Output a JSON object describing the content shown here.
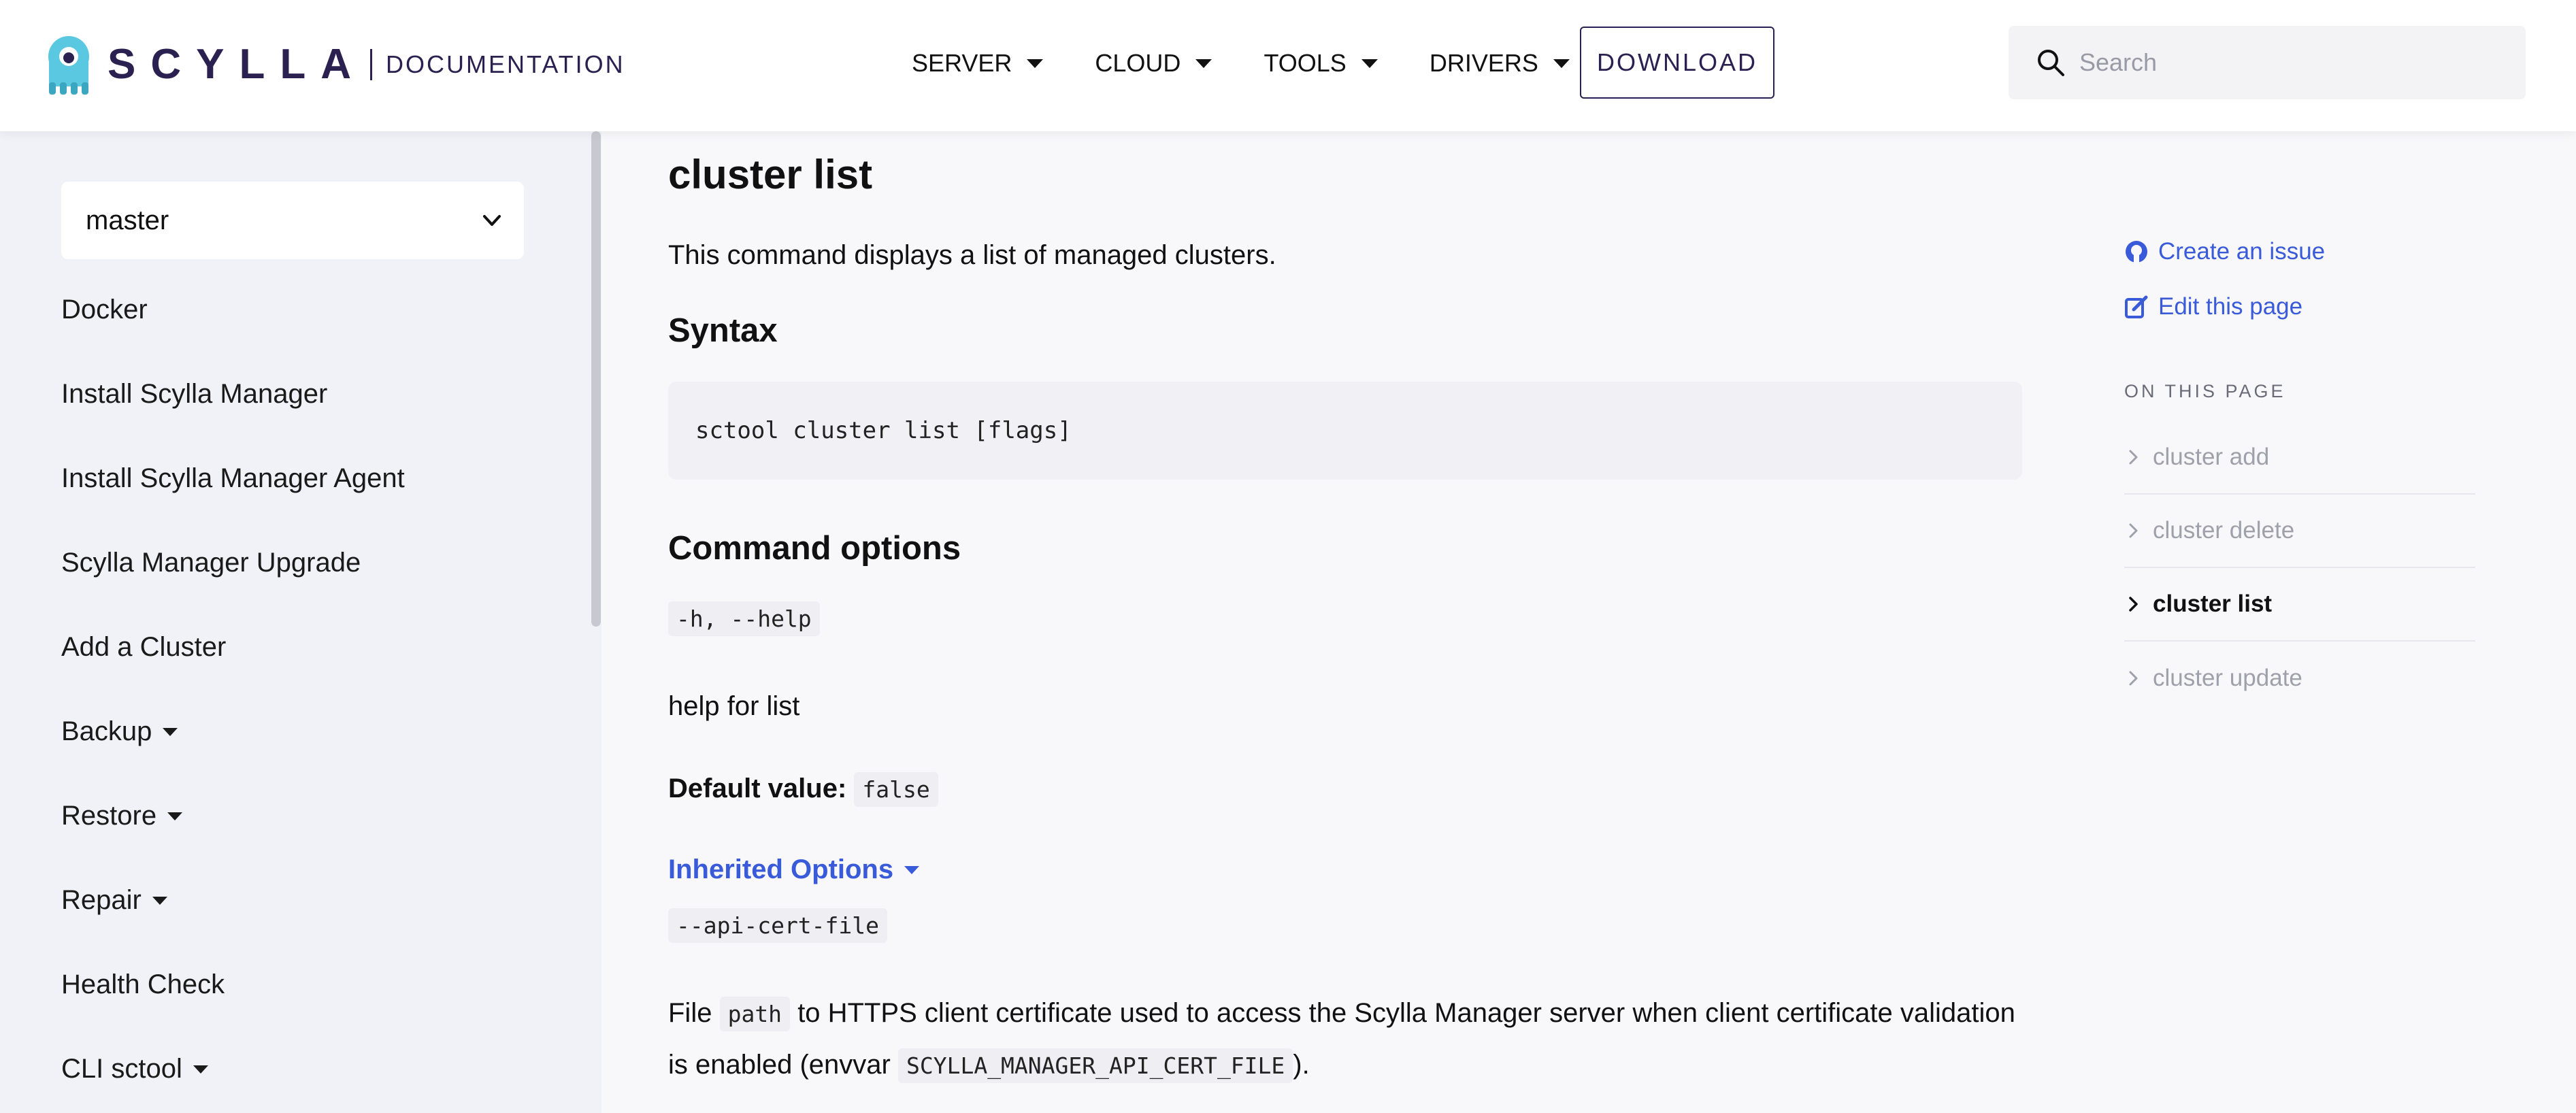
{
  "header": {
    "logo_word": "SCYLLA",
    "logo_section": "DOCUMENTATION",
    "nav": [
      {
        "label": "SERVER"
      },
      {
        "label": "CLOUD"
      },
      {
        "label": "TOOLS"
      },
      {
        "label": "DRIVERS"
      }
    ],
    "download_label": "DOWNLOAD",
    "search_placeholder": "Search"
  },
  "sidebar": {
    "version": "master",
    "items": [
      {
        "label": "Docker"
      },
      {
        "label": "Install Scylla Manager"
      },
      {
        "label": "Install Scylla Manager Agent"
      },
      {
        "label": "Scylla Manager Upgrade"
      },
      {
        "label": "Add a Cluster"
      },
      {
        "label": "Backup"
      },
      {
        "label": "Restore"
      },
      {
        "label": "Repair"
      },
      {
        "label": "Health Check"
      },
      {
        "label": "CLI sctool"
      }
    ]
  },
  "main": {
    "title": "cluster list",
    "intro": "This command displays a list of managed clusters.",
    "syntax_heading": "Syntax",
    "syntax_code": "sctool cluster list [flags]",
    "options_heading": "Command options",
    "opt_flag": "-h, --help",
    "opt_desc": "help for list",
    "default_label": "Default value:",
    "default_value": "false",
    "inherited_label": "Inherited Options",
    "inh_flag": "--api-cert-file",
    "inh_desc_pre": "File",
    "inh_desc_code": "path",
    "inh_desc_mid": "to HTTPS client certificate used to access the Scylla Manager server when client certificate validation",
    "inh_desc_line2_pre": "is enabled (envvar",
    "inh_desc_env": "SCYLLA_MANAGER_API_CERT_FILE",
    "inh_desc_line2_post": ")."
  },
  "right": {
    "create_issue": "Create an issue",
    "edit_page": "Edit this page",
    "toc_heading": "ON THIS PAGE",
    "toc": [
      {
        "label": "cluster add",
        "active": false
      },
      {
        "label": "cluster delete",
        "active": false
      },
      {
        "label": "cluster list",
        "active": true
      },
      {
        "label": "cluster update",
        "active": false
      }
    ]
  },
  "colors": {
    "brand": "#2b2150",
    "link": "#3a5bd9",
    "sidebar_bg": "#f1f1f8",
    "mascot": "#5ac8e0"
  }
}
